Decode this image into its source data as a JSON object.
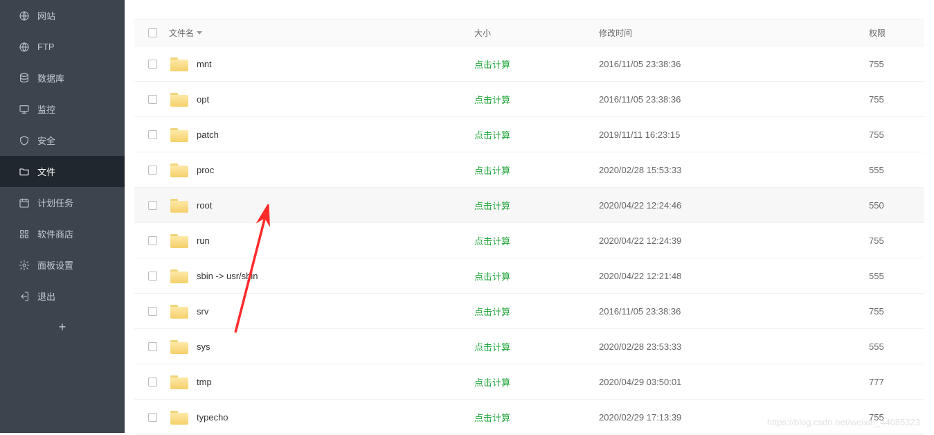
{
  "sidebar": {
    "items": [
      {
        "label": "网站",
        "icon": "globe",
        "active": false
      },
      {
        "label": "FTP",
        "icon": "ftp",
        "active": false
      },
      {
        "label": "数据库",
        "icon": "database",
        "active": false
      },
      {
        "label": "监控",
        "icon": "monitor",
        "active": false
      },
      {
        "label": "安全",
        "icon": "shield",
        "active": false
      },
      {
        "label": "文件",
        "icon": "folder",
        "active": true
      },
      {
        "label": "计划任务",
        "icon": "cron",
        "active": false
      },
      {
        "label": "软件商店",
        "icon": "apps",
        "active": false
      },
      {
        "label": "面板设置",
        "icon": "gear",
        "active": false
      },
      {
        "label": "退出",
        "icon": "exit",
        "active": false
      }
    ],
    "add_label": "+"
  },
  "table": {
    "header": {
      "name": "文件名",
      "size": "大小",
      "time": "修改时间",
      "perm": "权限"
    },
    "calc_label": "点击计算"
  },
  "files": [
    {
      "name": "mnt",
      "time": "2016/11/05 23:38:36",
      "perm": "755"
    },
    {
      "name": "opt",
      "time": "2016/11/05 23:38:36",
      "perm": "755"
    },
    {
      "name": "patch",
      "time": "2019/11/11 16:23:15",
      "perm": "755"
    },
    {
      "name": "proc",
      "time": "2020/02/28 15:53:33",
      "perm": "555"
    },
    {
      "name": "root",
      "time": "2020/04/22 12:24:46",
      "perm": "550",
      "highlight": true
    },
    {
      "name": "run",
      "time": "2020/04/22 12:24:39",
      "perm": "755"
    },
    {
      "name": "sbin -> usr/sbin",
      "time": "2020/04/22 12:21:48",
      "perm": "555"
    },
    {
      "name": "srv",
      "time": "2016/11/05 23:38:36",
      "perm": "755"
    },
    {
      "name": "sys",
      "time": "2020/02/28 23:53:33",
      "perm": "555"
    },
    {
      "name": "tmp",
      "time": "2020/04/29 03:50:01",
      "perm": "777"
    },
    {
      "name": "typecho",
      "time": "2020/02/29 17:13:39",
      "perm": "755"
    }
  ],
  "watermark": "https://blog.csdn.net/weixin_44085323"
}
